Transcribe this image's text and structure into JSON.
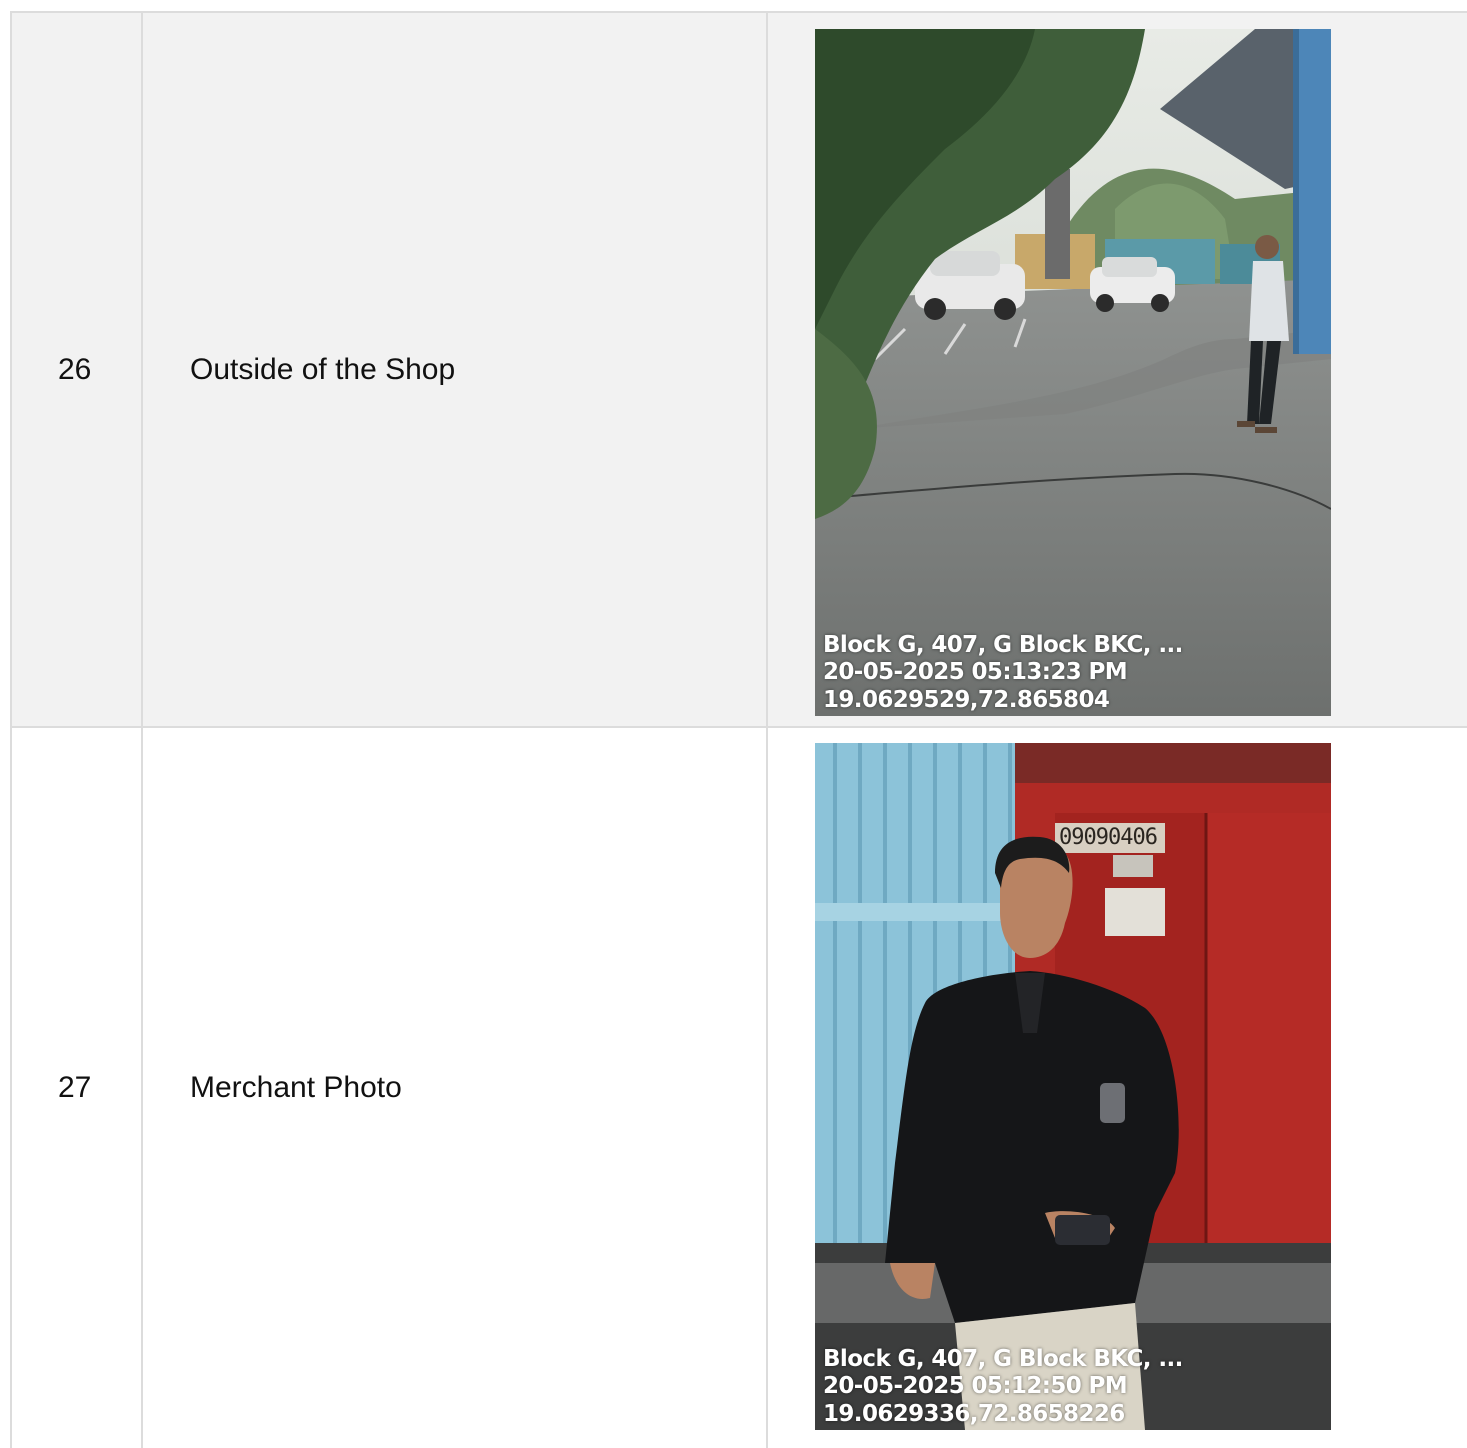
{
  "rows": [
    {
      "number": "26",
      "description": "Outside of the Shop",
      "photo": {
        "icon": "outdoor-parking-photo",
        "stamp_address": "Block G, 407, G Block BKC, ...",
        "stamp_datetime": "20-05-2025 05:13:23 PM",
        "stamp_coords": "19.0629529,72.865804"
      }
    },
    {
      "number": "27",
      "description": "Merchant Photo",
      "photo": {
        "icon": "merchant-portrait-photo",
        "door_code": "09090406",
        "stamp_address": "Block G, 407, G Block BKC, ...",
        "stamp_datetime": "20-05-2025 05:12:50 PM",
        "stamp_coords": "19.0629336,72.8658226"
      }
    }
  ]
}
